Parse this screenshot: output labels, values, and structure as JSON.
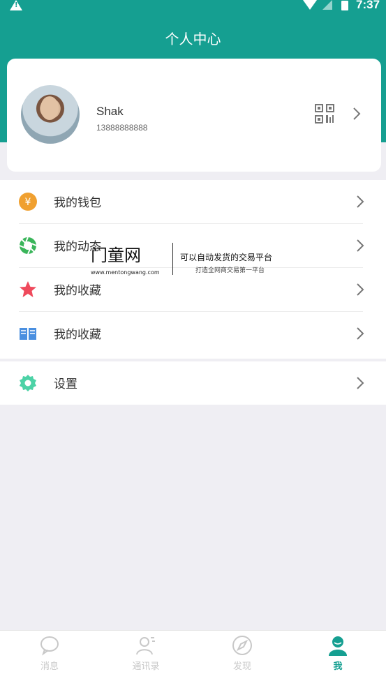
{
  "status_bar": {
    "time": "7:37"
  },
  "header": {
    "title": "个人中心"
  },
  "profile": {
    "name": "Shak",
    "phone": "13888888888"
  },
  "menu": [
    {
      "label": "我的钱包",
      "icon": "wallet-icon",
      "color": "#f0a030"
    },
    {
      "label": "我的动态",
      "icon": "camera-shutter-icon",
      "color": "#3ab55a"
    },
    {
      "label": "我的收藏",
      "icon": "star-icon",
      "color": "#ef4a5c"
    },
    {
      "label": "我的收藏",
      "icon": "book-icon",
      "color": "#4a8fe0"
    }
  ],
  "settings": {
    "label": "设置",
    "icon": "gear-icon",
    "color": "#4cd2a6"
  },
  "watermark": {
    "logo": "门童网",
    "url": "www.mentongwang.com",
    "slogan": "可以自动发货的交易平台",
    "sub": "打造全网商交易第一平台"
  },
  "tabs": [
    {
      "label": "消息",
      "icon": "chat-icon",
      "active": false
    },
    {
      "label": "通讯录",
      "icon": "contacts-icon",
      "active": false
    },
    {
      "label": "发现",
      "icon": "compass-icon",
      "active": false
    },
    {
      "label": "我",
      "icon": "person-icon",
      "active": true
    }
  ],
  "colors": {
    "primary": "#159f91",
    "background": "#efeef3"
  }
}
